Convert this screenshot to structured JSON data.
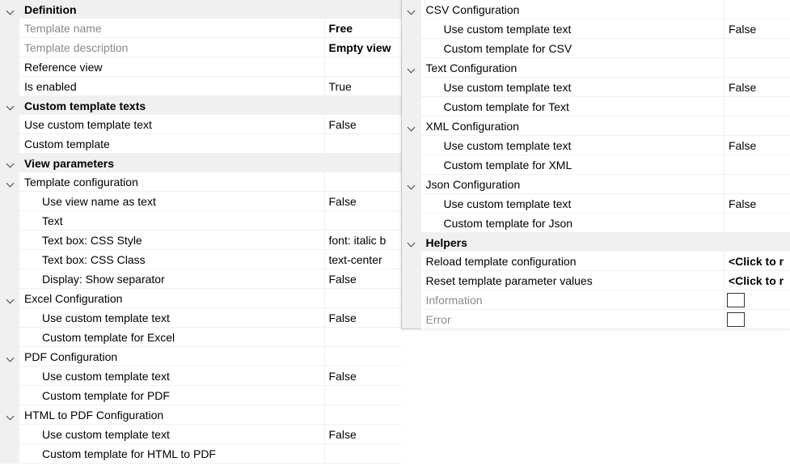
{
  "left": {
    "definition": {
      "header": "Definition",
      "template_name": {
        "label": "Template name",
        "value": "Free"
      },
      "template_description": {
        "label": "Template description",
        "value": "Empty view"
      },
      "reference_view": {
        "label": "Reference view",
        "value": ""
      },
      "is_enabled": {
        "label": "Is enabled",
        "value": "True"
      }
    },
    "custom_texts": {
      "header": "Custom template texts",
      "use_custom": {
        "label": "Use custom template text",
        "value": "False"
      },
      "custom_template": {
        "label": "Custom template",
        "value": ""
      }
    },
    "view_params": {
      "header": "View parameters",
      "template_config": {
        "label": "Template configuration",
        "use_view_name": {
          "label": "Use view name as text",
          "value": "False"
        },
        "text": {
          "label": "Text",
          "value": ""
        },
        "css_style": {
          "label": "Text box: CSS Style",
          "value": "font: italic b"
        },
        "css_class": {
          "label": "Text box: CSS Class",
          "value": "text-center"
        },
        "show_separator": {
          "label": "Display: Show separator",
          "value": "False"
        }
      },
      "excel": {
        "label": "Excel Configuration",
        "use_custom": {
          "label": "Use custom template text",
          "value": "False"
        },
        "custom": {
          "label": "Custom template for Excel",
          "value": ""
        }
      },
      "pdf": {
        "label": "PDF Configuration",
        "use_custom": {
          "label": "Use custom template text",
          "value": "False"
        },
        "custom": {
          "label": "Custom template for PDF",
          "value": ""
        }
      },
      "html_pdf": {
        "label": "HTML to PDF Configuration",
        "use_custom": {
          "label": "Use custom template text",
          "value": "False"
        },
        "custom": {
          "label": "Custom template for HTML to PDF",
          "value": ""
        }
      }
    }
  },
  "right": {
    "csv": {
      "label": "CSV Configuration",
      "use_custom": {
        "label": "Use custom template text",
        "value": "False"
      },
      "custom": {
        "label": "Custom template for CSV",
        "value": ""
      }
    },
    "text": {
      "label": "Text Configuration",
      "use_custom": {
        "label": "Use custom template text",
        "value": "False"
      },
      "custom": {
        "label": "Custom template for Text",
        "value": ""
      }
    },
    "xml": {
      "label": "XML Configuration",
      "use_custom": {
        "label": "Use custom template text",
        "value": "False"
      },
      "custom": {
        "label": "Custom template for XML",
        "value": ""
      }
    },
    "json": {
      "label": "Json Configuration",
      "use_custom": {
        "label": "Use custom template text",
        "value": "False"
      },
      "custom": {
        "label": "Custom template for Json",
        "value": ""
      }
    },
    "helpers": {
      "header": "Helpers",
      "reload": {
        "label": "Reload template configuration",
        "value": "<Click to r"
      },
      "reset": {
        "label": "Reset template parameter values",
        "value": "<Click to r"
      },
      "information": {
        "label": "Information"
      },
      "error": {
        "label": "Error"
      }
    }
  },
  "icons": {
    "expander": "chevron-down-icon",
    "checkbox": "checkbox-icon"
  },
  "colors": {
    "category_bg": "#f0f0f0",
    "disabled_text": "#8a8a8a",
    "border": "#c8c8c8"
  }
}
